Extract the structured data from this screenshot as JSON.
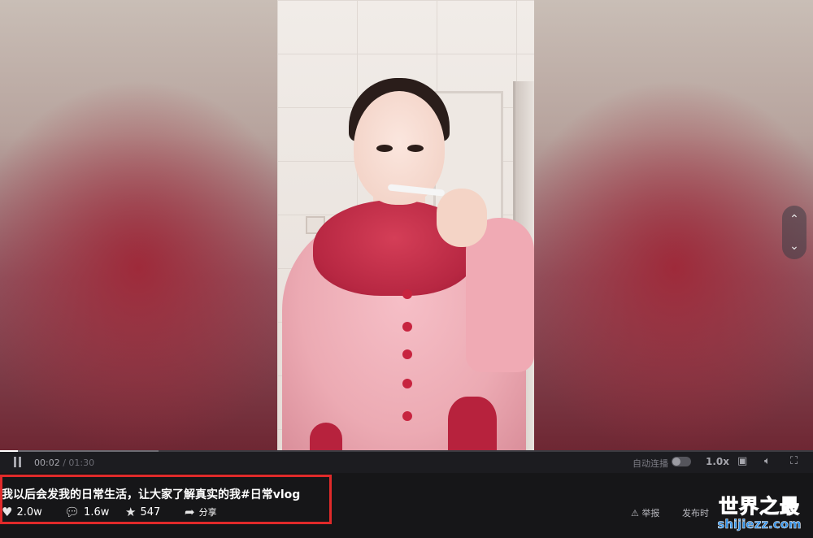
{
  "player": {
    "current_time": "00:02",
    "separator": "/",
    "total_time": "01:30",
    "progress_fraction": 0.022,
    "buffered_fraction": 0.195,
    "autoplay_label": "自动连播",
    "speed_label": "1.0x"
  },
  "nav": {
    "up_icon": "chevron-up-icon",
    "down_icon": "chevron-down-icon"
  },
  "video": {
    "title": "我以后会发我的日常生活，让大家了解真实的我#日常vlog"
  },
  "stats": {
    "likes": "2.0w",
    "comments": "1.6w",
    "favorites": "547",
    "share_label": "分享"
  },
  "actions": {
    "report_label": "举报",
    "publish_label": "发布时"
  },
  "watermark": {
    "title": "世界之最",
    "url": "shijiezz.com"
  },
  "colors": {
    "highlight_border": "#e02a2a",
    "watermark_blue": "#2f8fe6"
  }
}
